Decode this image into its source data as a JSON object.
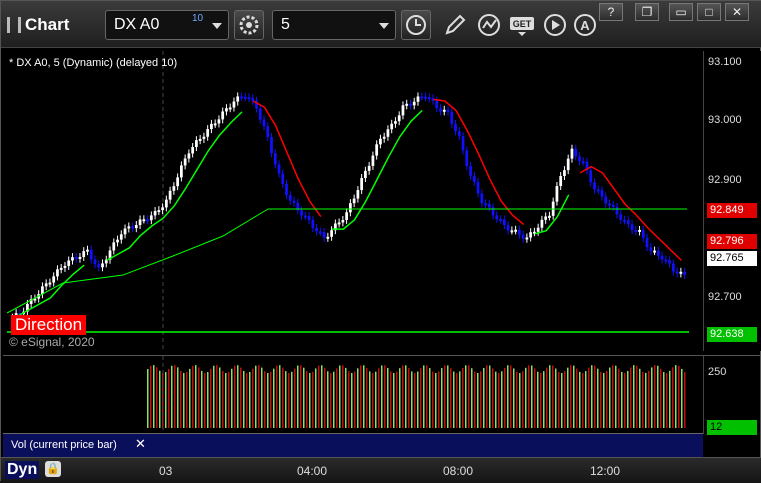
{
  "app": {
    "title": "Chart"
  },
  "toolbar": {
    "symbol": "DX A0",
    "symbol_delay": "10",
    "interval": "5"
  },
  "chart": {
    "header": "* DX A0, 5 (Dynamic) (delayed 10)",
    "direction_label": "Direction",
    "copyright": "© eSignal, 2020",
    "price_labels": [
      "93.100",
      "93.000",
      "92.900",
      "92.700"
    ],
    "tags": {
      "red_upper": "92.849",
      "red_lower": "92.796",
      "last": "92.765",
      "green": "92.638"
    },
    "colors": {
      "up": "#ffffff",
      "down": "#1010ff",
      "red_ma": "#ff0000",
      "green_ma": "#00ff00"
    }
  },
  "volume": {
    "label": "Vol (current price bar)",
    "axis_label": "250",
    "current_tag": "12"
  },
  "time_axis": {
    "labels": [
      "03",
      "04:00",
      "08:00",
      "12:00"
    ]
  },
  "bottom": {
    "mode": "Dyn"
  },
  "chart_data": {
    "type": "candlestick",
    "title": "* DX A0, 5 (Dynamic) (delayed 10)",
    "ylim": [
      92.64,
      93.12
    ],
    "x_ticks": [
      "03",
      "04:00",
      "08:00",
      "12:00"
    ],
    "y_ticks": [
      92.7,
      92.8,
      92.9,
      93.0,
      93.1
    ],
    "reference_lines": [
      {
        "value": 92.638,
        "color": "#00ff00"
      }
    ],
    "series": [
      {
        "name": "close",
        "values": [
          92.7,
          92.72,
          92.74,
          92.76,
          92.78,
          92.79,
          92.8,
          92.77,
          92.8,
          92.83,
          92.84,
          92.85,
          92.86,
          92.88,
          92.92,
          92.96,
          92.98,
          93.0,
          93.02,
          93.04,
          93.05,
          93.03,
          92.98,
          92.92,
          92.88,
          92.86,
          92.84,
          92.82,
          92.84,
          92.86,
          92.9,
          92.94,
          92.98,
          93.0,
          93.03,
          93.04,
          93.05,
          93.03,
          93.02,
          92.98,
          92.92,
          92.88,
          92.86,
          92.84,
          92.83,
          92.82,
          92.84,
          92.86,
          92.92,
          92.96,
          92.94,
          92.9,
          92.88,
          92.86,
          92.84,
          92.83,
          92.8,
          92.79,
          92.77,
          92.76
        ]
      }
    ]
  }
}
